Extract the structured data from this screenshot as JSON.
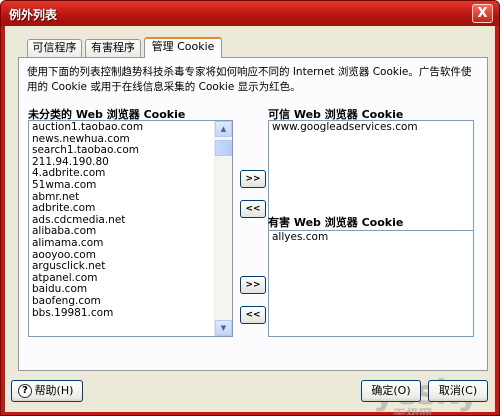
{
  "window": {
    "title": "例外列表",
    "close_glyph": "X"
  },
  "tabs": [
    {
      "label": "可信程序"
    },
    {
      "label": "有害程序"
    },
    {
      "label": "管理 Cookie"
    }
  ],
  "description": "使用下面的列表控制趋势科技杀毒专家将如何响应不同的 Internet 浏览器 Cookie。广告软件使用的 Cookie 或用于在线信息采集的 Cookie 显示为红色。",
  "uncategorized": {
    "label": "未分类的 Web 浏览器 Cookie",
    "items": [
      "auction1.taobao.com",
      "news.newhua.com",
      "search1.taobao.com",
      "211.94.190.80",
      "4.adbrite.com",
      "51wma.com",
      "abmr.net",
      "adbrite.com",
      "ads.cdcmedia.net",
      "alibaba.com",
      "alimama.com",
      "aooyoo.com",
      "argusclick.net",
      "atpanel.com",
      "baidu.com",
      "baofeng.com",
      "bbs.19981.com"
    ]
  },
  "trusted": {
    "label": "可信 Web 浏览器 Cookie",
    "items": [
      "www.googleadservices.com"
    ]
  },
  "harmful": {
    "label": "有害 Web 浏览器 Cookie",
    "items": [
      "allyes.com"
    ]
  },
  "move_buttons": {
    "move_right": ">>",
    "move_left": "<<"
  },
  "buttons": {
    "help": "帮助(H)",
    "ok": "确定(O)",
    "cancel": "取消(C)"
  },
  "watermark": {
    "text": "yesky",
    "sub": "天极网"
  }
}
